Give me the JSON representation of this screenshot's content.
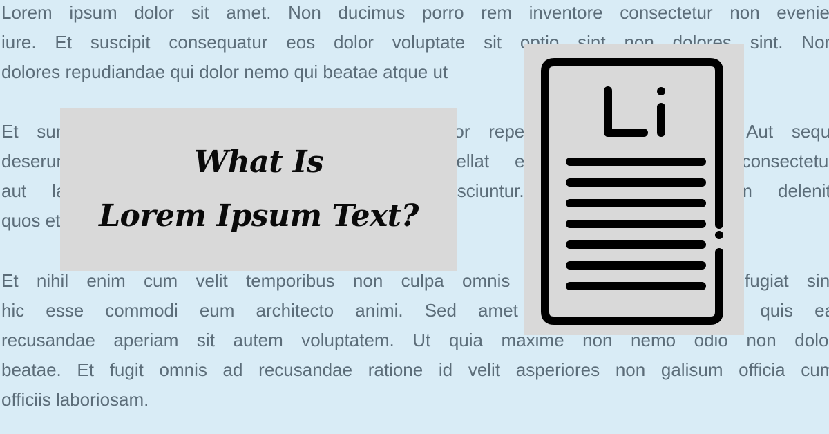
{
  "background_color": "#d9ecf6",
  "body_text": {
    "color": "#5c6d79",
    "paragraphs": [
      {
        "lines": [
          "Lorem ipsum dolor sit amet. Non ducimus porro rem inventore consectetur non eveniet",
          "iure. Et suscipit consequatur eos dolor voluptate sit optio sint non dolores sint. Non",
          "dolores repudiandae qui dolor nemo qui beatae atque ut"
        ]
      },
      {
        "lines": [
          "Et sunt quia nam voluptas quibusdam aut dolor repellat aliquid qui nemo. Aut sequi",
          "deserunt aut voluptas dolorem ut quia repellat est nihil sunt eum consectetur",
          "aut laborum ut dolorum odit et sequi nesciuntur. Et quia dolor eum deleniti",
          "quos et velit."
        ]
      },
      {
        "lines": [
          "Et nihil enim cum velit temporibus non culpa omnis eum quia quam quo fugiat sint",
          "hic esse commodi eum architecto animi. Sed amet nihil quia quos non quis ea",
          "recusandae aperiam sit autem voluptatem. Ut quia maxime non nemo odio non dolor",
          "beatae. Et fugit omnis ad recusandae ratione id velit asperiores non galisum officia cum",
          "officiis laboriosam."
        ]
      }
    ]
  },
  "title_card": {
    "background": "#d9d9d9",
    "line1": "What Is",
    "line2": "Lorem Ipsum Text?"
  },
  "icon_card": {
    "background": "#d9d9d9",
    "icon": "lorem-ipsum-document-icon",
    "glyph_text": "Li",
    "text_line_count": 7
  }
}
